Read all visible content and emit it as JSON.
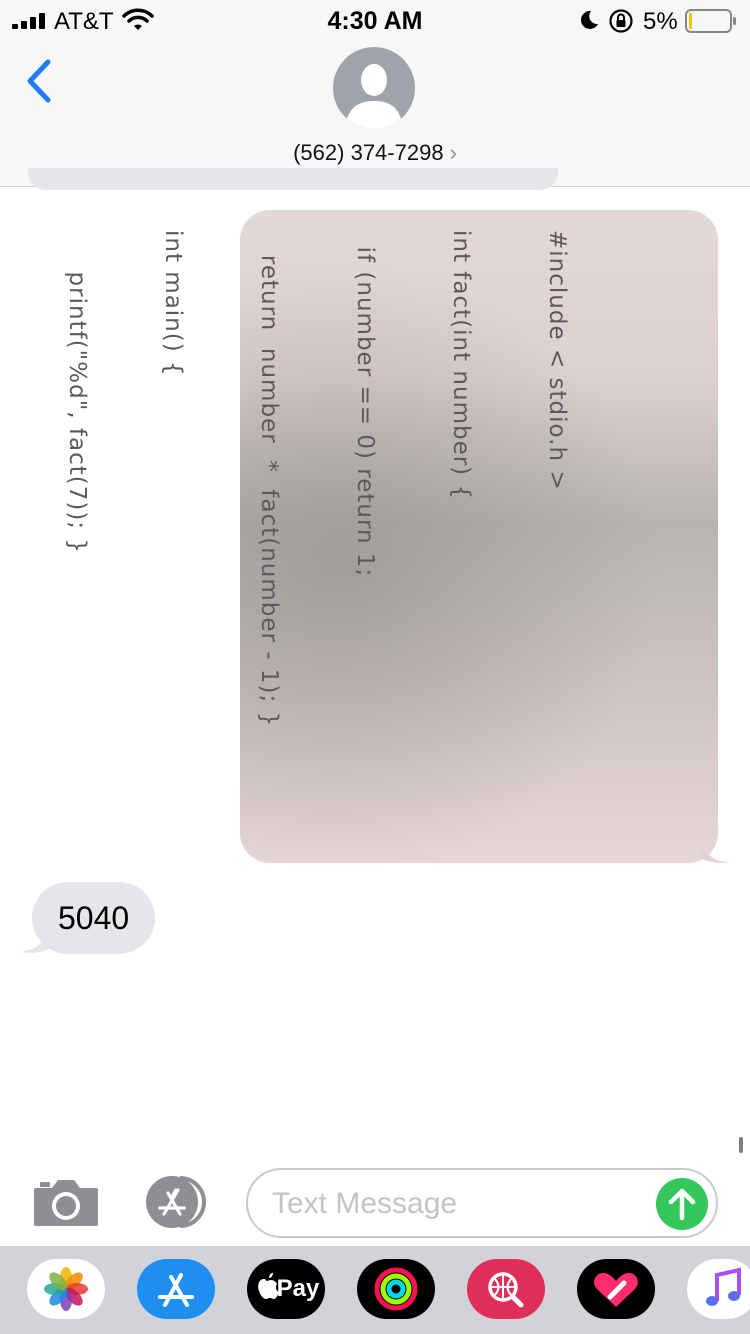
{
  "status_bar": {
    "carrier": "AT&T",
    "time": "4:30 AM",
    "battery_percent": "5%",
    "battery_level": 0.05
  },
  "header": {
    "contact": "(562) 374-7298",
    "chevron": "›"
  },
  "messages": [
    {
      "type": "sent-photo",
      "handwritten_code": [
        "#include < stdio.h >",
        "int fact(int number) {",
        "  if (number == 0) return 1;",
        "   return  number  *  fact(number - 1); }",
        "int main() {",
        "     printf(\"%d\", fact(7)); }"
      ]
    },
    {
      "type": "received",
      "text": "5040"
    }
  ],
  "composer": {
    "placeholder": "Text Message"
  },
  "app_drawer": {
    "apple_pay_label": "Pay",
    "apps": [
      "photos-icon",
      "app-store-icon",
      "apple-pay-icon",
      "activity-icon",
      "web-search-icon",
      "digital-touch-icon",
      "music-icon"
    ]
  },
  "colors": {
    "ios_blue": "#1f7cf6",
    "received_bubble": "#e5e5ea",
    "send_green": "#34c759",
    "drawer_bg": "#d1d3d9"
  }
}
